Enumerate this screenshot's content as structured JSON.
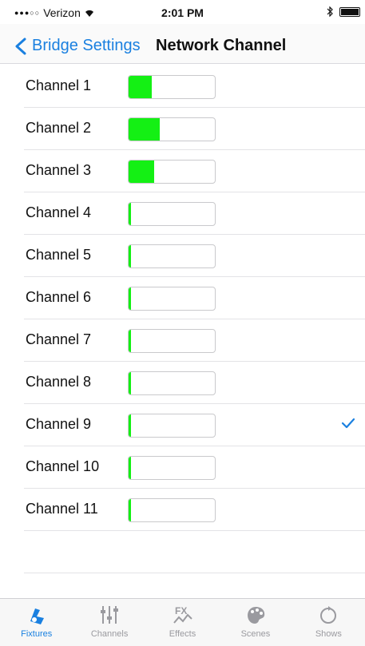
{
  "status_bar": {
    "signal": "●●●○○",
    "carrier": "Verizon",
    "time": "2:01 PM"
  },
  "nav": {
    "back_label": "Bridge Settings",
    "title": "Network Channel"
  },
  "channels": [
    {
      "label": "Channel 1",
      "level": 0.27,
      "selected": false
    },
    {
      "label": "Channel 2",
      "level": 0.36,
      "selected": false
    },
    {
      "label": "Channel 3",
      "level": 0.3,
      "selected": false
    },
    {
      "label": "Channel 4",
      "level": 0.02,
      "selected": false
    },
    {
      "label": "Channel 5",
      "level": 0.01,
      "selected": false
    },
    {
      "label": "Channel 6",
      "level": 0.03,
      "selected": false
    },
    {
      "label": "Channel 7",
      "level": 0.01,
      "selected": false
    },
    {
      "label": "Channel 8",
      "level": 0.01,
      "selected": false
    },
    {
      "label": "Channel 9",
      "level": 0.01,
      "selected": true
    },
    {
      "label": "Channel 10",
      "level": 0.01,
      "selected": false
    },
    {
      "label": "Channel 11",
      "level": 0.01,
      "selected": false
    }
  ],
  "tabs": [
    {
      "label": "Fixtures",
      "icon": "fixtures-icon",
      "active": true
    },
    {
      "label": "Channels",
      "icon": "channels-icon",
      "active": false
    },
    {
      "label": "Effects",
      "icon": "effects-icon",
      "active": false
    },
    {
      "label": "Scenes",
      "icon": "scenes-icon",
      "active": false
    },
    {
      "label": "Shows",
      "icon": "shows-icon",
      "active": false
    }
  ],
  "colors": {
    "accent": "#1a80e0",
    "meter_fill": "#14f014",
    "inactive_tab": "#9a9a9f"
  }
}
